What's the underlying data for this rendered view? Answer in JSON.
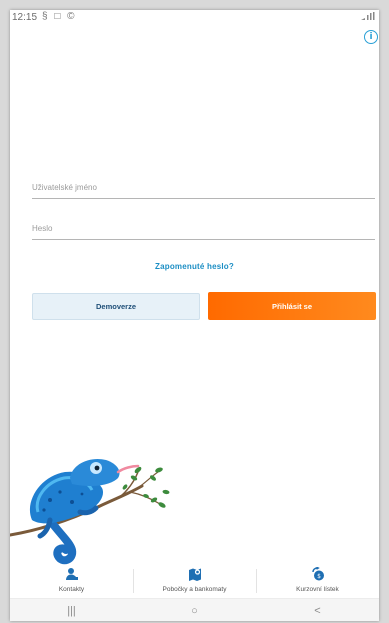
{
  "statusbar": {
    "time": "12:15",
    "icons_left": "§ □ ©",
    "icons_right": "‹..│"
  },
  "info_icon": "info-icon",
  "login": {
    "username_placeholder": "Uživatelské jméno",
    "username_value": "",
    "password_placeholder": "Heslo",
    "password_value": "",
    "forgot_label": "Zapomenuté heslo?",
    "demo_label": "Demoverze",
    "login_label": "Přihlásit se"
  },
  "colors": {
    "accent_blue": "#1c8ec4",
    "login_orange": "#ff7a10",
    "demo_bg": "#e7f1f8"
  },
  "bottom_nav": {
    "items": [
      {
        "label": "Kontakty",
        "icon": "contacts-icon"
      },
      {
        "label": "Pobočky a bankomaty",
        "icon": "map-pin-icon"
      },
      {
        "label": "Kurzovní lístek",
        "icon": "exchange-rate-icon"
      }
    ]
  },
  "system_nav": {
    "recents": "|||",
    "home": "○",
    "back": "<"
  }
}
